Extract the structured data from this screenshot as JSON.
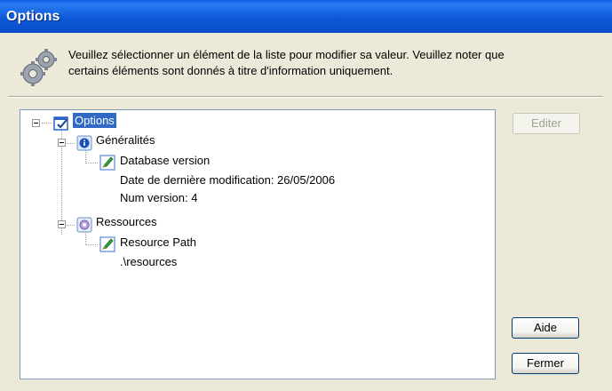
{
  "window": {
    "title": "Options"
  },
  "header": {
    "icon": "gears-icon",
    "instructions_line1": "Veuillez sélectionner un élément de la liste pour modifier sa valeur. Veuillez noter que",
    "instructions_line2": "certains éléments sont donnés à titre d'information uniquement."
  },
  "tree": {
    "root": {
      "label": "Options",
      "icon": "options-checklist-icon",
      "expanded": true,
      "selected": true
    },
    "groups": [
      {
        "label": "Généralités",
        "icon": "info-icon",
        "expanded": true,
        "items": [
          {
            "label": "Database version",
            "icon": "edit-pencil-icon",
            "values": [
              "Date de dernière modification: 26/05/2006",
              "Num version: 4"
            ]
          }
        ]
      },
      {
        "label": "Ressources",
        "icon": "resources-icon",
        "expanded": true,
        "items": [
          {
            "label": "Resource Path",
            "icon": "edit-pencil-icon",
            "values": [
              ".\\resources"
            ]
          }
        ]
      }
    ]
  },
  "buttons": {
    "edit_label": "Editer",
    "edit_enabled": false,
    "help_label": "Aide",
    "close_label": "Fermer"
  },
  "colors": {
    "titlebar": "#0a58d8",
    "selection": "#316ac5",
    "dialog_bg": "#ece9d8"
  }
}
